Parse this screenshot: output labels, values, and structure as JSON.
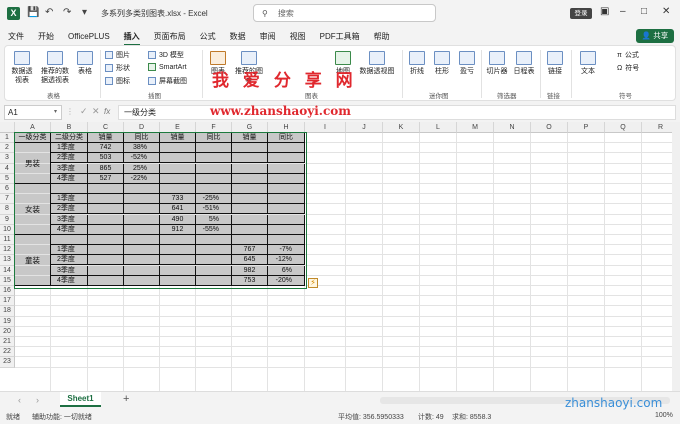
{
  "titlebar": {
    "filename": "多系列多类别图表.xlsx - Excel",
    "search_placeholder": "搜索",
    "login": "登录",
    "app_logo": "X"
  },
  "menu": [
    "文件",
    "开始",
    "OfficePLUS",
    "插入",
    "页面布局",
    "公式",
    "数据",
    "审阅",
    "视图",
    "PDF工具箱",
    "帮助"
  ],
  "menu_active": "插入",
  "share": "共享",
  "ribbon": {
    "pivot": "数据透视表",
    "rec_pivot": "推荐的数据透视表",
    "table": "表格",
    "group_table": "表格",
    "picture": "图片",
    "shape": "形状",
    "icon": "图标",
    "model3d": "3D 模型",
    "smartart": "SmartArt",
    "screenshot": "屏幕截图",
    "group_illus": "插图",
    "chart": "图表",
    "rec_chart": "推荐的图表",
    "map": "地图",
    "pivot_chart": "数据透视图",
    "group_chart": "图表",
    "line": "折线",
    "column": "柱形",
    "winloss": "盈亏",
    "group_spark": "迷你图",
    "slicer": "切片器",
    "timeline": "日程表",
    "group_filter": "筛选器",
    "link": "链接",
    "group_link": "链接",
    "text": "文本",
    "formula": "公式",
    "symbol": "符号",
    "group_symbol": "符号"
  },
  "watermark": "我 爱 分 享 网",
  "watermark_url": "www.zhanshaoyi.com",
  "formula_bar": {
    "namebox": "A1",
    "fx": "fx",
    "content": "一级分类"
  },
  "columns": [
    "A",
    "B",
    "C",
    "D",
    "E",
    "F",
    "G",
    "H",
    "I",
    "J",
    "K",
    "L",
    "M",
    "N",
    "O",
    "P",
    "Q",
    "R"
  ],
  "rows": [
    "1",
    "2",
    "3",
    "4",
    "5",
    "6",
    "7",
    "8",
    "9",
    "10",
    "11",
    "12",
    "13",
    "14",
    "15",
    "16",
    "17",
    "18",
    "19",
    "20",
    "21",
    "22",
    "23"
  ],
  "table": {
    "header": [
      "一级分类",
      "二级分类",
      "销量",
      "同比",
      "销量",
      "同比",
      "销量",
      "同比"
    ],
    "groups": [
      "男装",
      "女装",
      "童装"
    ],
    "quarters": [
      "1季度",
      "2季度",
      "3季度",
      "4季度"
    ],
    "men_sales": [
      "742",
      "503",
      "865",
      "527"
    ],
    "men_yoy": [
      "38%",
      "-52%",
      "25%",
      "-22%"
    ],
    "women_sales": [
      "733",
      "641",
      "490",
      "912"
    ],
    "women_yoy": [
      "-25%",
      "-51%",
      "5%",
      "-55%"
    ],
    "kids_sales": [
      "767",
      "645",
      "982",
      "753"
    ],
    "kids_yoy": [
      "-7%",
      "-12%",
      "6%",
      "-20%"
    ]
  },
  "sheet_tab": "Sheet1",
  "add_tab": "+",
  "status": {
    "ready": "就绪",
    "accessibility": "辅助功能: 一切就绪",
    "average": "平均值: 356.5950333",
    "count": "计数: 49",
    "sum": "求和: 8558.3",
    "zoom": "100%"
  },
  "site_watermark": "zhanshaoyi.com"
}
